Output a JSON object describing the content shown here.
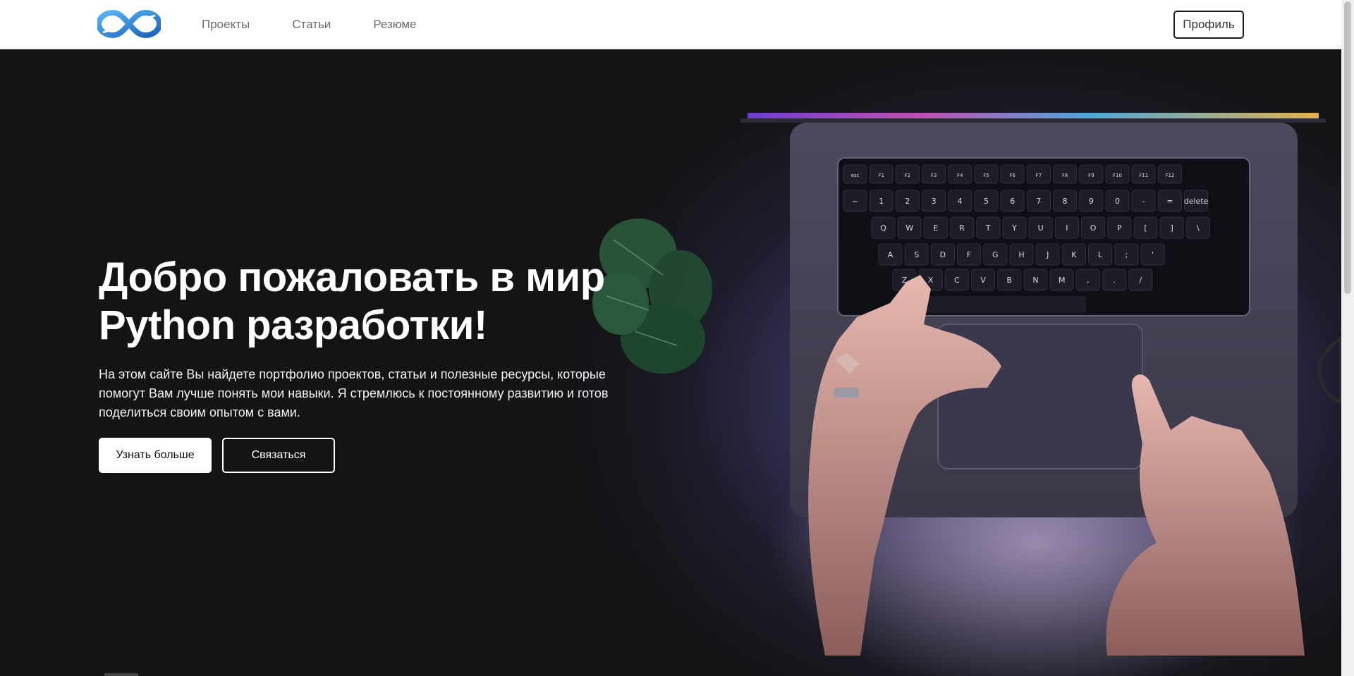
{
  "header": {
    "logo_icon": "infinity-logo-icon",
    "nav": [
      {
        "label": "Проекты"
      },
      {
        "label": "Статьи"
      },
      {
        "label": "Резюме"
      }
    ],
    "profile_label": "Профиль"
  },
  "hero": {
    "title_line1": "Добро пожаловать в мир",
    "title_line2": "Python разработки!",
    "text": "На этом сайте Вы найдете портфолио проектов, статьи и полезные ресурсы, которые помогут Вам лучше понять мои навыки. Я стремлюсь к постоянному развитию и готов поделиться своим опытом с вами.",
    "btn_more": "Узнать больше",
    "btn_contact": "Связаться",
    "keyboard_fn_row": [
      "esc",
      "F1",
      "F2",
      "F3",
      "F4",
      "F5",
      "F6",
      "F7",
      "F8",
      "F9",
      "F10",
      "F11",
      "F12"
    ],
    "keyboard_num_row": [
      "~",
      "1",
      "2",
      "3",
      "4",
      "5",
      "6",
      "7",
      "8",
      "9",
      "0",
      "-",
      "=",
      "delete"
    ],
    "keyboard_row_q": [
      "Q",
      "W",
      "E",
      "R",
      "T",
      "Y",
      "U",
      "I",
      "O",
      "P",
      "[",
      "]",
      "\\"
    ],
    "keyboard_row_a": [
      "A",
      "S",
      "D",
      "F",
      "G",
      "H",
      "J",
      "K",
      "L",
      ";",
      "'"
    ],
    "keyboard_row_z": [
      "Z",
      "X",
      "C",
      "V",
      "B",
      "N",
      "M",
      ",",
      ".",
      "/"
    ]
  },
  "colors": {
    "hero_bg": "#141416",
    "accent_logo": "#2a7fd4",
    "header_bg": "#ffffff"
  }
}
